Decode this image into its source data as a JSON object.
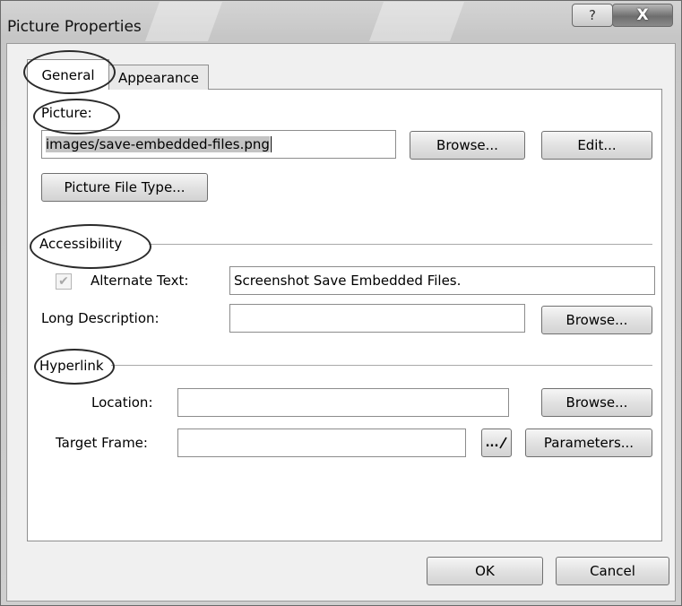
{
  "window": {
    "title": "Picture Properties",
    "help_glyph": "?",
    "close_glyph": "X"
  },
  "tabs": [
    {
      "label": "General",
      "selected": true
    },
    {
      "label": "Appearance",
      "selected": false
    }
  ],
  "picture": {
    "section_label": "Picture:",
    "path_value": "images/save-embedded-files.png",
    "browse_label": "Browse...",
    "edit_label": "Edit...",
    "file_type_label": "Picture File Type..."
  },
  "accessibility": {
    "section_label": "Accessibility",
    "alt_checked": true,
    "alt_label": "Alternate Text:",
    "alt_value": "Screenshot Save Embedded Files.",
    "long_desc_label": "Long Description:",
    "long_desc_value": "",
    "browse_label": "Browse..."
  },
  "hyperlink": {
    "section_label": "Hyperlink",
    "location_label": "Location:",
    "location_value": "",
    "location_browse_label": "Browse...",
    "target_label": "Target Frame:",
    "target_value": "",
    "target_picker_glyph": "...",
    "parameters_label": "Parameters..."
  },
  "footer": {
    "ok_label": "OK",
    "cancel_label": "Cancel"
  },
  "colors": {
    "frame": "#c9c9c9",
    "panel": "#ffffff",
    "dialog_bg": "#f0f0f0"
  }
}
